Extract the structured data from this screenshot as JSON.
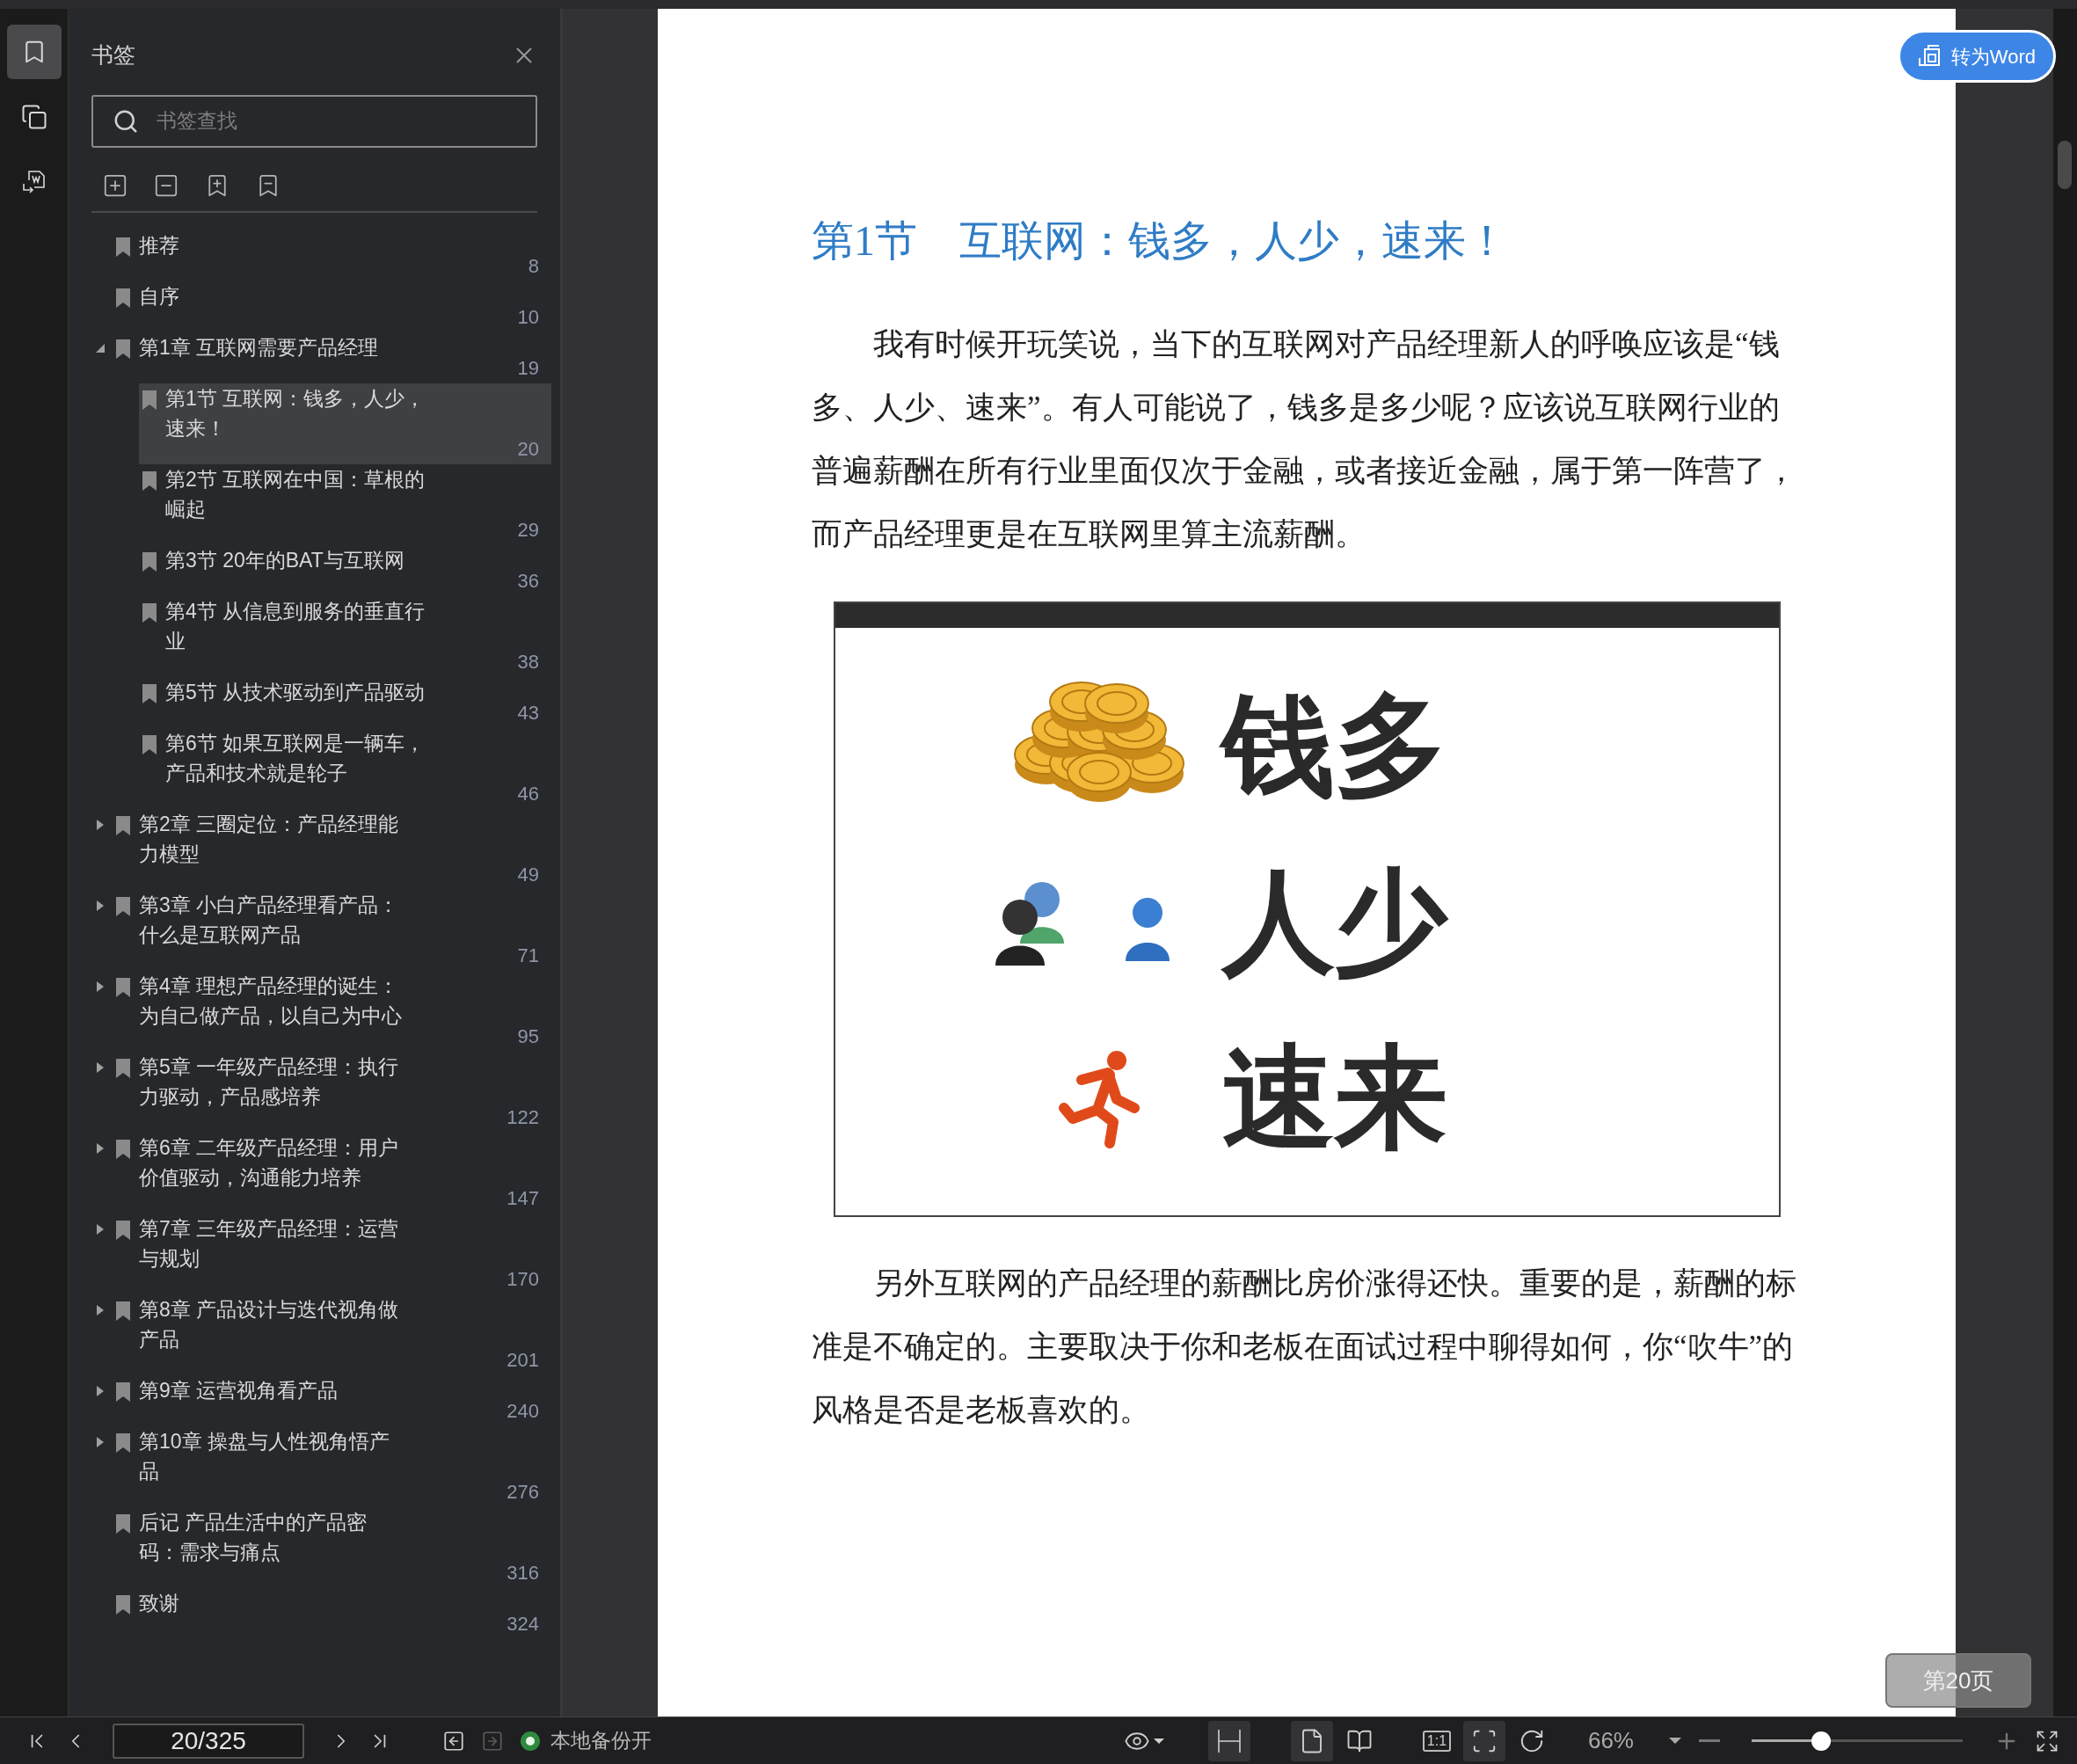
{
  "rail": [
    {
      "kind": "bookmark",
      "selected": true
    },
    {
      "kind": "pages",
      "selected": false
    },
    {
      "kind": "convert",
      "selected": false
    }
  ],
  "panel": {
    "title": "书签",
    "search": {
      "placeholder": "书签查找"
    }
  },
  "bookmarks": [
    {
      "label": "推荐",
      "page": "8",
      "selected": false
    },
    {
      "label": "自序",
      "page": "10",
      "selected": false
    },
    {
      "label": "第1章 互联网需要产品经理",
      "page": "19",
      "selected": false,
      "expanded": true,
      "children": [
        {
          "label": "第1节 互联网：钱多，人少，速来！",
          "page": "20",
          "selected": true
        },
        {
          "label": "第2节 互联网在中国：草根的崛起",
          "page": "29",
          "selected": false
        },
        {
          "label": "第3节 20年的BAT与互联网",
          "page": "36",
          "selected": false
        },
        {
          "label": "第4节 从信息到服务的垂直行业",
          "page": "38",
          "selected": false
        },
        {
          "label": "第5节 从技术驱动到产品驱动",
          "page": "43",
          "selected": false
        },
        {
          "label": "第6节 如果互联网是一辆车，产品和技术就是轮子",
          "page": "46",
          "selected": false
        }
      ]
    },
    {
      "label": "第2章 三圈定位：产品经理能力模型",
      "page": "49",
      "selected": false,
      "expanded": false
    },
    {
      "label": "第3章 小白产品经理看产品：什么是互联网产品",
      "page": "71",
      "selected": false,
      "expanded": false
    },
    {
      "label": "第4章 理想产品经理的诞生：为自己做产品，以自己为中心",
      "page": "95",
      "selected": false,
      "expanded": false
    },
    {
      "label": "第5章 一年级产品经理：执行力驱动，产品感培养",
      "page": "122",
      "selected": false,
      "expanded": false
    },
    {
      "label": "第6章 二年级产品经理：用户价值驱动，沟通能力培养",
      "page": "147",
      "selected": false,
      "expanded": false
    },
    {
      "label": "第7章 三年级产品经理：运营与规划",
      "page": "170",
      "selected": false,
      "expanded": false
    },
    {
      "label": "第8章 产品设计与迭代视角做产品",
      "page": "201",
      "selected": false,
      "expanded": false
    },
    {
      "label": "第9章 运营视角看产品",
      "page": "240",
      "selected": false,
      "expanded": false
    },
    {
      "label": "第10章 操盘与人性视角悟产品",
      "page": "276",
      "selected": false,
      "expanded": false
    },
    {
      "label": "后记 产品生活中的产品密码：需求与痛点",
      "page": "316",
      "selected": false
    },
    {
      "label": "致谢",
      "page": "324",
      "selected": false
    }
  ],
  "page": {
    "heading": "第1节　互联网：钱多，人少，速来！",
    "paragraphs": [
      "我有时候开玩笑说，当下的互联网对产品经理新人的呼唤应该是“钱多、人少、速来”。有人可能说了，钱多是多少呢？应该说互联网行业的普遍薪酬在所有行业里面仅次于金融，或者接近金融，属于第一阵营了，而产品经理更是在互联网里算主流薪酬。",
      "另外互联网的产品经理的薪酬比房价涨得还快。重要的是，薪酬的标准是不确定的。主要取决于你和老板在面试过程中聊得如何，你“吹牛”的风格是否是老板喜欢的。"
    ],
    "figure": [
      {
        "kind": "coins",
        "text": "钱多"
      },
      {
        "kind": "people",
        "text": "人少"
      },
      {
        "kind": "runner",
        "text": "速来"
      }
    ],
    "convert_button": "转为Word",
    "page_badge": "第20页"
  },
  "bottom": {
    "nav": [
      {
        "kind": "first",
        "disabled": false
      },
      {
        "kind": "prev",
        "disabled": false
      }
    ],
    "page_field": "20/325",
    "nav2": [
      {
        "kind": "next",
        "disabled": false
      },
      {
        "kind": "last",
        "disabled": false
      }
    ],
    "history": [
      {
        "kind": "back",
        "disabled": false
      },
      {
        "kind": "forward",
        "disabled": true
      }
    ],
    "backup": {
      "label": "本地备份开",
      "on": true
    },
    "views": [
      {
        "kind": "fit-width",
        "selected": true
      },
      {
        "kind": "single-page",
        "selected": true
      },
      {
        "kind": "two-page",
        "selected": false
      }
    ],
    "fits": [
      {
        "kind": "actual-size",
        "label": "1:1",
        "selected": false
      },
      {
        "kind": "fit-page",
        "selected": true
      },
      {
        "kind": "rotate",
        "selected": false
      }
    ],
    "zoom": {
      "value": "66%",
      "level": 0.33
    }
  }
}
